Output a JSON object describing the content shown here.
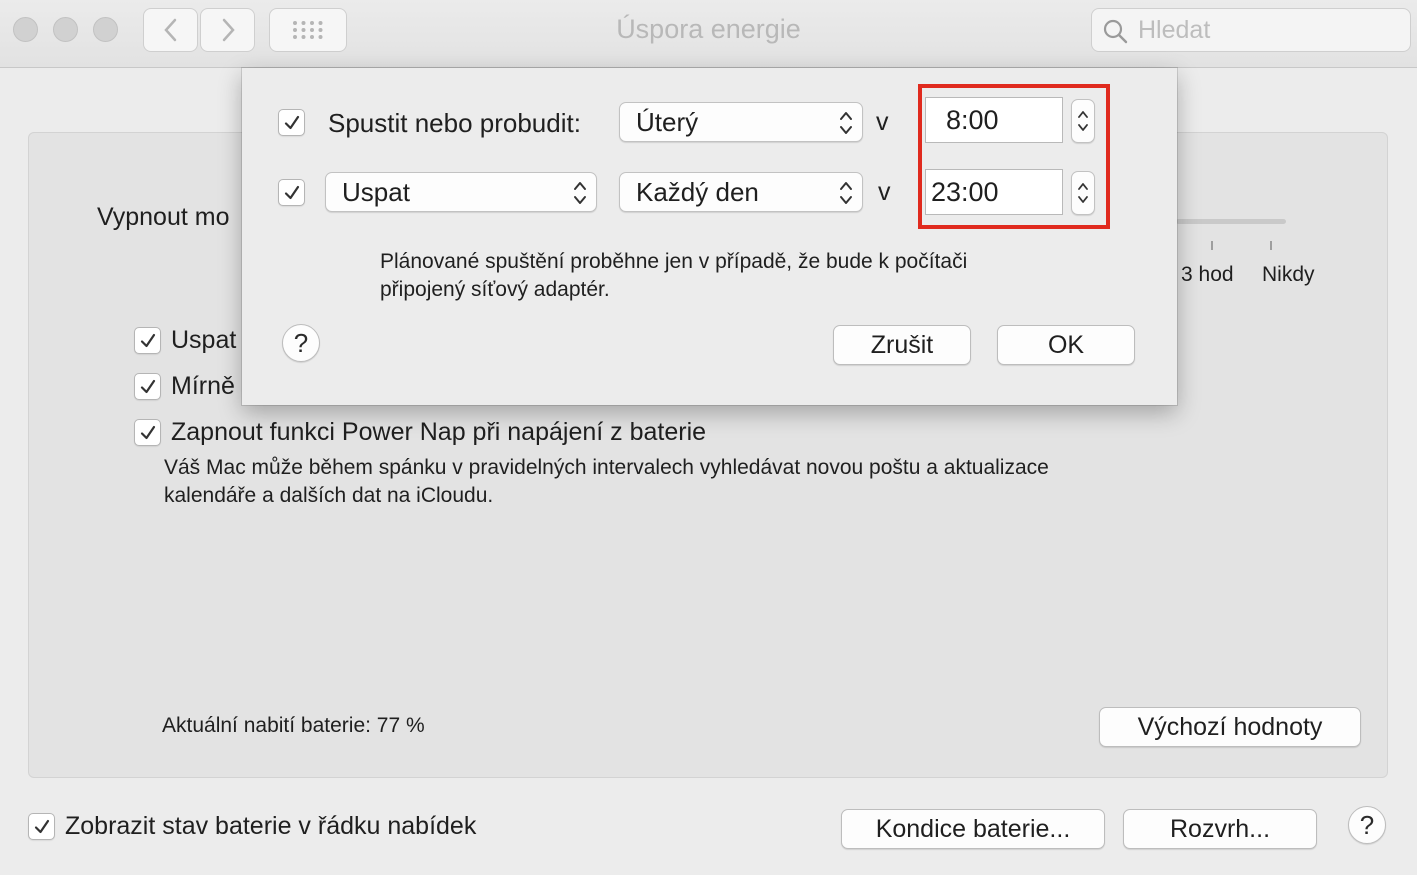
{
  "window": {
    "title": "Úspora energie",
    "search_placeholder": "Hledat"
  },
  "background": {
    "vypnout_label_partial": "Vypnout mo",
    "slider_ticks": [
      "3 hod",
      "Nikdy"
    ],
    "uspat_partial": "Uspat",
    "mirne_partial": "Mírně",
    "power_nap": {
      "checked": true,
      "label": "Zapnout funkci Power Nap při napájení z baterie",
      "description_line1": "Váš Mac může během spánku v pravidelných intervalech vyhledávat novou poštu a aktualizace",
      "description_line2": "kalendáře a dalších dat na iCloudu."
    },
    "battery_charge": "Aktuální nabití baterie: 77 %",
    "defaults_button": "Výchozí hodnoty",
    "show_battery_status": {
      "checked": true,
      "label": "Zobrazit stav baterie v řádku nabídek"
    },
    "battery_health_button": "Kondice baterie...",
    "schedule_button": "Rozvrh...",
    "help": "?"
  },
  "dialog": {
    "row1": {
      "checked": true,
      "label": "Spustit nebo probudit:",
      "day": "Úterý",
      "at": "v",
      "time": "8:00"
    },
    "row2": {
      "checked": true,
      "action": "Uspat",
      "day": "Každý den",
      "at": "v",
      "time": "23:00"
    },
    "note_line1": "Plánované spuštění proběhne jen v případě, že bude k počítači",
    "note_line2": "připojený síťový adaptér.",
    "help": "?",
    "cancel_button": "Zrušit",
    "ok_button": "OK"
  },
  "colors": {
    "highlight": "#e02a1e"
  }
}
